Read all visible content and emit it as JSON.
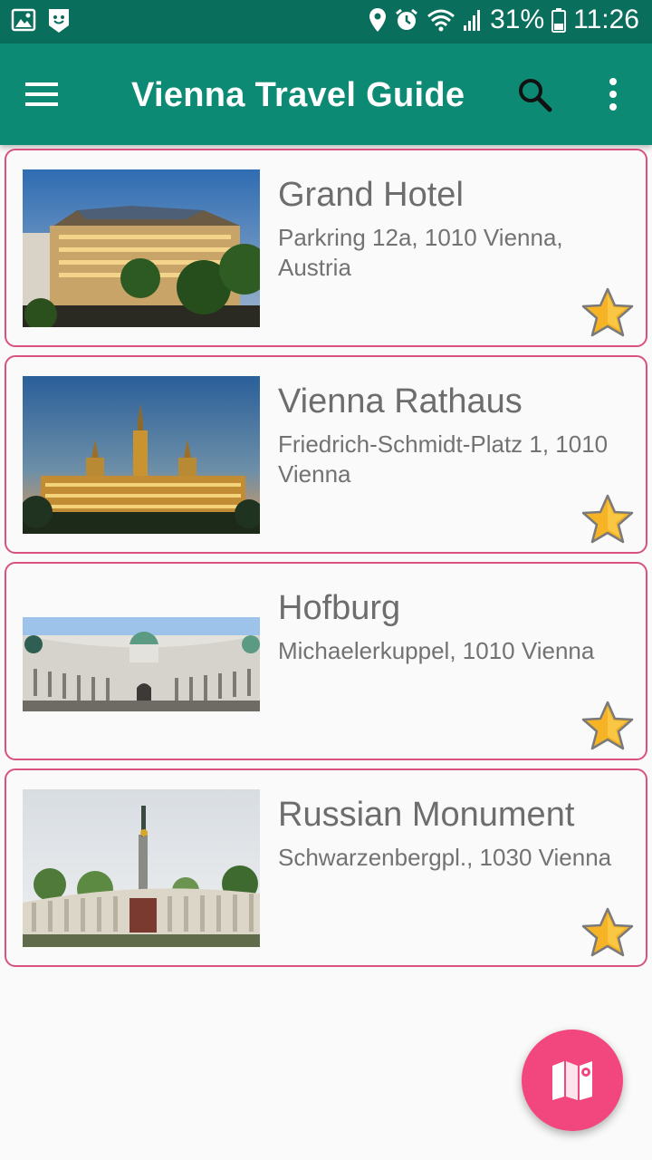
{
  "status_bar": {
    "battery": "31%",
    "time": "11:26",
    "icons": [
      "image-icon",
      "smiley-notification-icon",
      "location-icon",
      "alarm-icon",
      "wifi-icon",
      "signal-icon",
      "battery-icon"
    ]
  },
  "app_bar": {
    "title": "Vienna Travel Guide",
    "icons": [
      "menu-icon",
      "search-icon",
      "more-vert-icon"
    ],
    "color": "#0c8a73"
  },
  "places": [
    {
      "name": "Grand Hotel",
      "address": "Parkring 12a, 1010 Vienna, Austria",
      "favorite": true
    },
    {
      "name": "Vienna Rathaus",
      "address": "Friedrich-Schmidt-Platz 1, 1010 Vienna",
      "favorite": true
    },
    {
      "name": "Hofburg",
      "address": "Michaelerkuppel, 1010 Vienna",
      "favorite": true
    },
    {
      "name": "Russian Monument",
      "address": "Schwarzenbergpl., 1030 Vienna",
      "favorite": true
    }
  ],
  "fab": {
    "icon": "map-icon",
    "color": "#f2477e"
  },
  "colors": {
    "card_border": "#d8517f",
    "star": "#f5b325"
  }
}
